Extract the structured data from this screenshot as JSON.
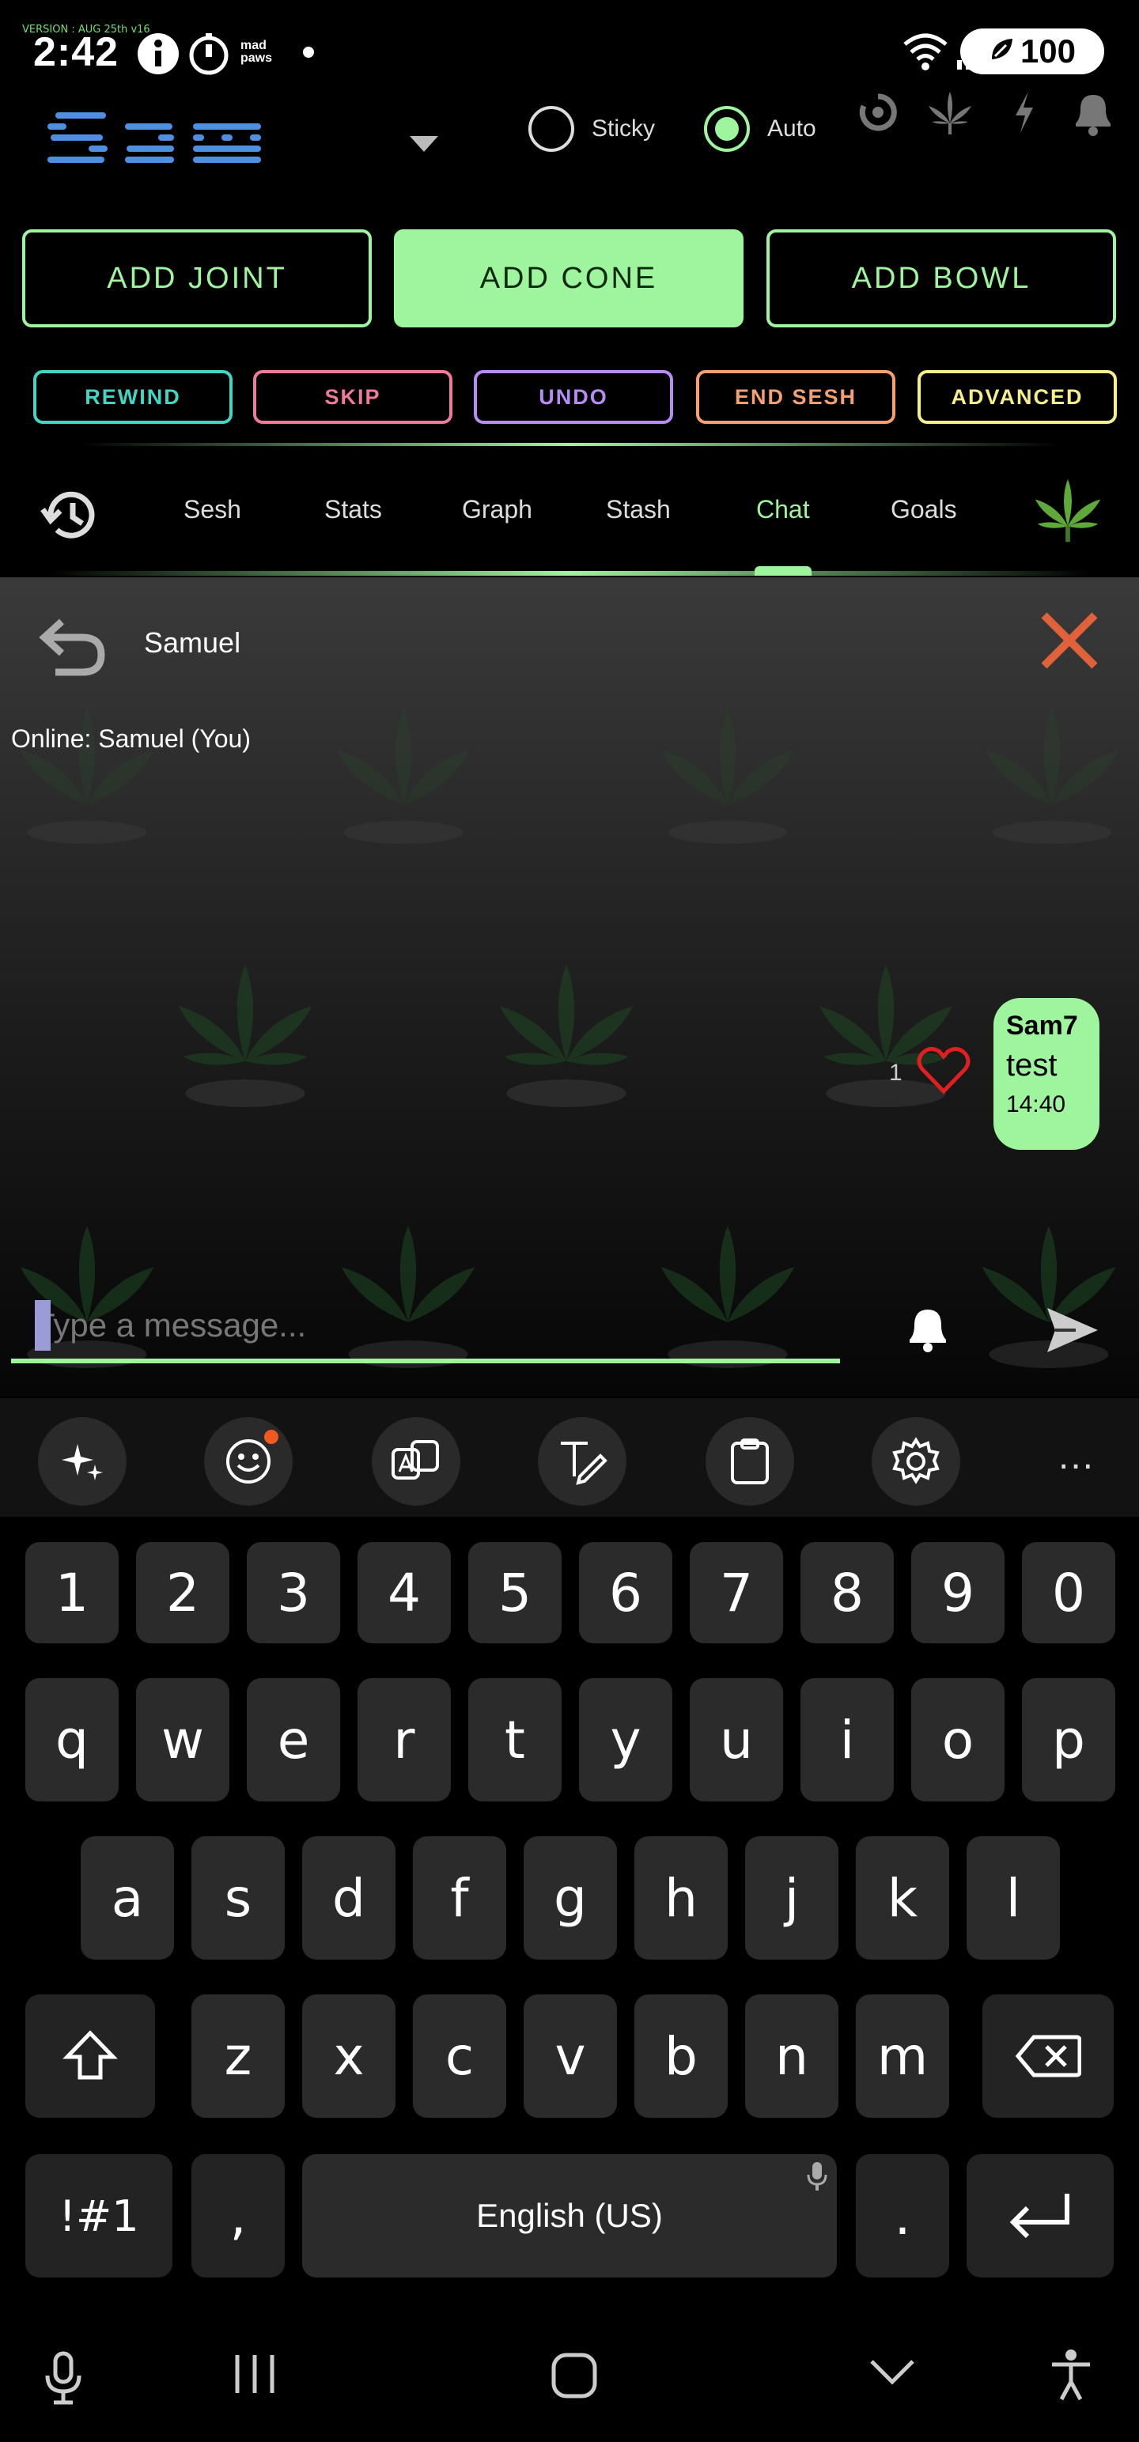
{
  "status": {
    "version": "VERSION : AUG 25th v16",
    "time": "2:42",
    "battery": "100",
    "app_badge": "mad paws"
  },
  "header": {
    "logo": "Sam",
    "sticky_label": "Sticky",
    "auto_label": "Auto",
    "sticky_selected": false,
    "auto_selected": true,
    "icons": [
      "loading-icon",
      "leaf-icon",
      "bolt-icon",
      "bell-icon"
    ]
  },
  "actions": {
    "add_joint": "ADD JOINT",
    "add_cone": "ADD CONE",
    "add_bowl": "ADD BOWL",
    "rewind": "REWIND",
    "skip": "SKIP",
    "undo": "UNDO",
    "end_sesh": "END SESH",
    "advanced": "ADVANCED"
  },
  "colors": {
    "accent": "#9ef59e",
    "rewind": "#3fd6c6",
    "skip": "#f07a9a",
    "undo": "#b78cf5",
    "end_sesh": "#f5a070",
    "advanced": "#f5ee8a",
    "close": "#e0623a"
  },
  "tabs": {
    "items": [
      {
        "label": "Sesh"
      },
      {
        "label": "Stats"
      },
      {
        "label": "Graph"
      },
      {
        "label": "Stash"
      },
      {
        "label": "Chat"
      },
      {
        "label": "Goals"
      }
    ],
    "active": "Chat"
  },
  "chat": {
    "title": "Samuel",
    "online": "Online: Samuel (You)",
    "messages": [
      {
        "author": "Sam7",
        "text": "test",
        "time": "14:40",
        "likes": "1"
      }
    ],
    "input_placeholder": "Type a message..."
  },
  "keyboard": {
    "numbers": [
      "1",
      "2",
      "3",
      "4",
      "5",
      "6",
      "7",
      "8",
      "9",
      "0"
    ],
    "row1": [
      "q",
      "w",
      "e",
      "r",
      "t",
      "y",
      "u",
      "i",
      "o",
      "p"
    ],
    "row2": [
      "a",
      "s",
      "d",
      "f",
      "g",
      "h",
      "j",
      "k",
      "l"
    ],
    "row3": [
      "z",
      "x",
      "c",
      "v",
      "b",
      "n",
      "m"
    ],
    "symbols": "!#1",
    "comma": ",",
    "space": "English (US)",
    "period": ".",
    "more": "..."
  }
}
